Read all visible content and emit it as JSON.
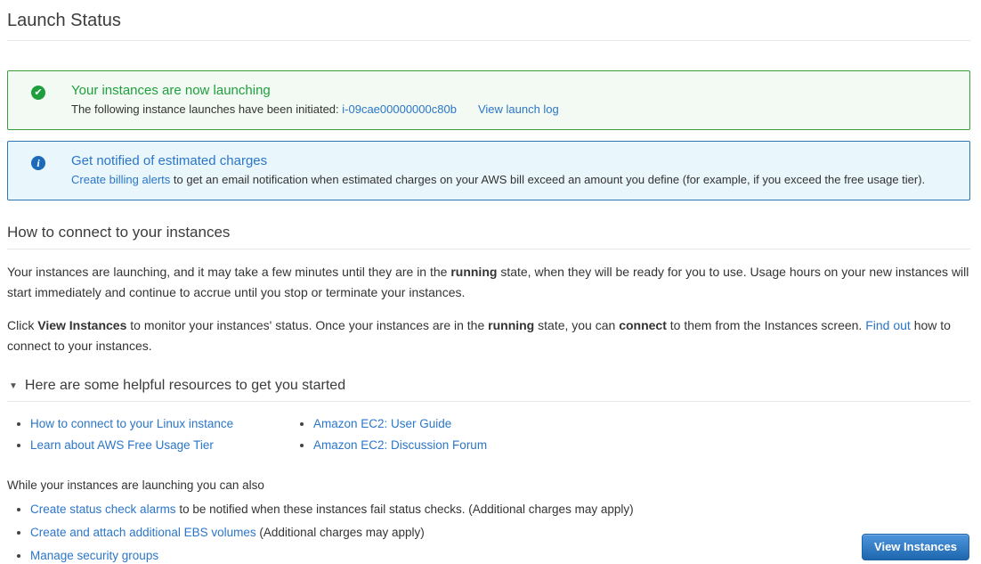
{
  "page": {
    "title": "Launch Status"
  },
  "colors": {
    "link_blue": "#2b76c9",
    "success_green": "#1f9e3d",
    "success_border": "#3a9d3a",
    "success_bg": "#f3faf3",
    "info_blue": "#1c6bba",
    "info_border": "#2d76b5",
    "info_bg": "#e9f6fb",
    "button_gradient_top": "#4d95dd",
    "button_gradient_bottom": "#1e66ae"
  },
  "icons": {
    "success_glyph": "✔",
    "info_glyph": "i",
    "collapse_glyph": "▼"
  },
  "success_banner": {
    "icon": "check-circle-icon",
    "title": "Your instances are now launching",
    "message_prefix": "The following instance launches have been initiated: ",
    "instance_id": "i-09cae00000000c80b",
    "view_launch_log_label": "View launch log"
  },
  "info_banner": {
    "icon": "info-circle-icon",
    "title": "Get notified of estimated charges",
    "link_label": "Create billing alerts",
    "message": " to get an email notification when estimated charges on your AWS bill exceed an amount you define (for example, if you exceed the free usage tier)."
  },
  "connect_section": {
    "heading": "How to connect to your instances",
    "p1_a": "Your instances are launching, and it may take a few minutes until they are in the ",
    "p1_bold1": "running",
    "p1_b": " state, when they will be ready for you to use. Usage hours on your new instances will start immediately and continue to accrue until you stop or terminate your instances.",
    "p2_a": "Click ",
    "p2_bold1": "View Instances",
    "p2_b": " to monitor your instances' status. Once your instances are in the ",
    "p2_bold2": "running",
    "p2_c": " state, you can ",
    "p2_bold3": "connect",
    "p2_d": " to them from the Instances screen. ",
    "p2_link": "Find out",
    "p2_e": " how to connect to your instances."
  },
  "resources_section": {
    "heading": "Here are some helpful resources to get you started",
    "col1": [
      {
        "label": "How to connect to your Linux instance"
      },
      {
        "label": "Learn about AWS Free Usage Tier"
      }
    ],
    "col2": [
      {
        "label": "Amazon EC2: User Guide"
      },
      {
        "label": "Amazon EC2: Discussion Forum"
      }
    ]
  },
  "launching_section": {
    "intro": "While your instances are launching you can also",
    "items": [
      {
        "link": "Create status check alarms",
        "text": " to be notified when these instances fail status checks. (Additional charges may apply)"
      },
      {
        "link": "Create and attach additional EBS volumes",
        "text": " (Additional charges may apply)"
      },
      {
        "link": "Manage security groups",
        "text": ""
      }
    ]
  },
  "footer": {
    "view_instances_label": "View Instances"
  }
}
